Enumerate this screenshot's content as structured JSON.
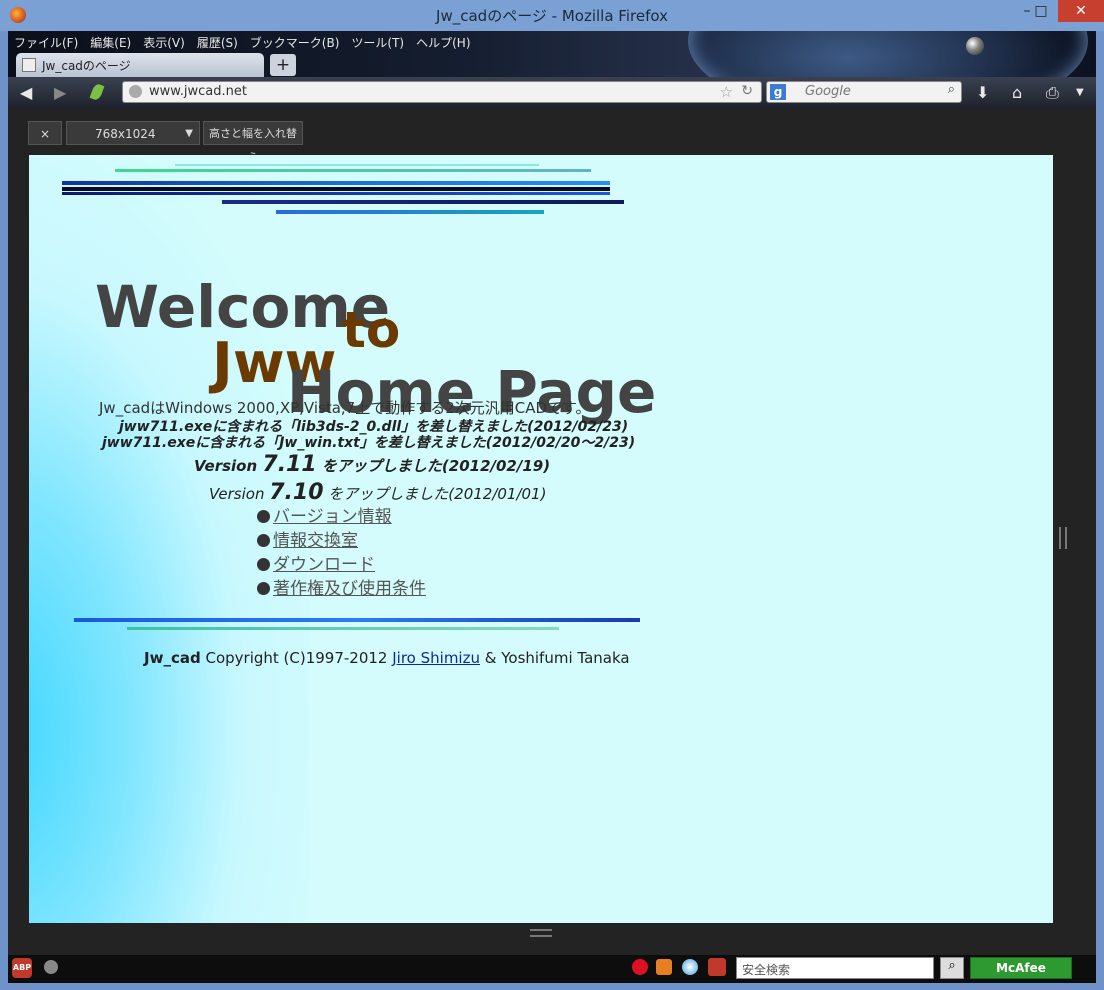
{
  "window": {
    "title": "Jw_cadのページ - Mozilla Firefox",
    "minimize": "–",
    "maximize": "□",
    "close": "✕"
  },
  "menu": [
    "ファイル(F)",
    "編集(E)",
    "表示(V)",
    "履歴(S)",
    "ブックマーク(B)",
    "ツール(T)",
    "ヘルプ(H)"
  ],
  "tab": {
    "label": "Jw_cadのページ",
    "new_tab": "+"
  },
  "navbar": {
    "url": "www.jwcad.net",
    "search_placeholder": "Google"
  },
  "responsive": {
    "close": "×",
    "size": "768x1024",
    "rotate": "高さと幅を入れ替え"
  },
  "page": {
    "welcome": "Welcome",
    "to": "to",
    "jww": "Jww",
    "home_page": "Home Page",
    "description": "Jw_cadはWindows 2000,XP,Vista,7上で動作する2次元汎用CADです。",
    "update1": "jww711.exeに含まれる「lib3ds-2_0.dll」を差し替えました(2012/02/23)",
    "update2": "jww711.exeに含まれる「Jw_win.txt」を差し替えました(2012/02/20〜2/23)",
    "v711_prefix": "Version",
    "v711_num": "7.11",
    "v711_suffix": "をアップしました(2012/02/19)",
    "v710_prefix": "Version",
    "v710_num": "7.10",
    "v710_suffix": "をアップしました(2012/01/01)",
    "links": [
      "バージョン情報",
      "情報交換室",
      "ダウンロード",
      "著作権及び使用条件"
    ],
    "footer_app": "Jw_cad",
    "footer_copy": " Copyright (C)1997-2012 ",
    "footer_author": "Jiro Shimizu",
    "footer_rest": " & Yoshifumi Tanaka"
  },
  "statusbar": {
    "abp": "ABP",
    "safe_search": "安全検索",
    "mcafee": "McAfee"
  },
  "colors": {
    "welcome": "#444444",
    "jww": "#6a3a00",
    "page_bg": "#d4fcfc"
  }
}
